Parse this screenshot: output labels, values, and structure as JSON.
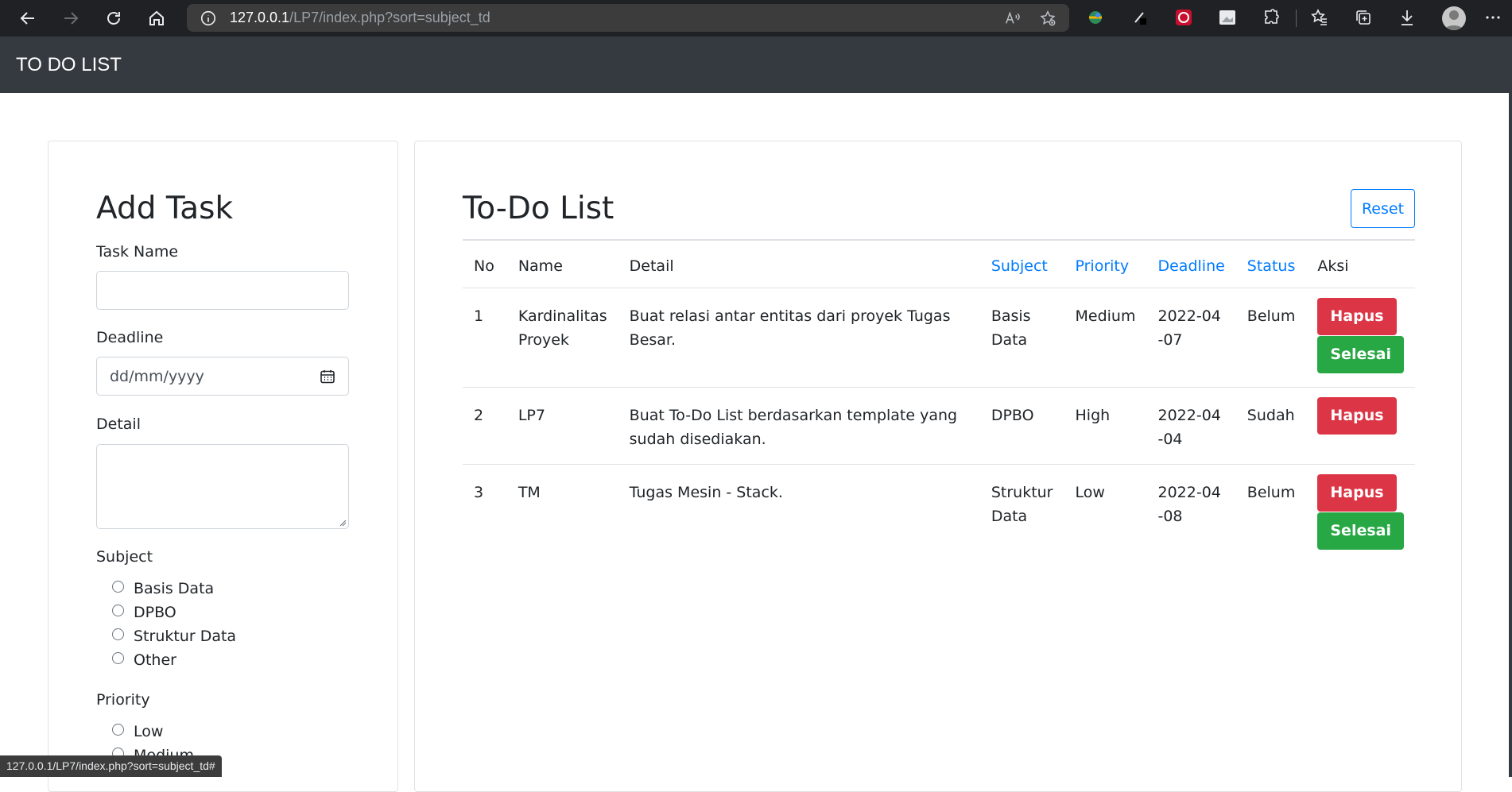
{
  "browser": {
    "url_host": "127.0.0.1",
    "url_path": "/LP7/index.php?sort=subject_td",
    "icons": [
      "back-icon",
      "forward-icon",
      "refresh-icon",
      "home-icon",
      "info-icon",
      "read-aloud-icon",
      "favorite-add-icon",
      "extension-icon",
      "favorites-icon",
      "collections-icon",
      "downloads-icon",
      "profile-icon",
      "more-icon"
    ]
  },
  "navbar": {
    "brand": "TO DO LIST"
  },
  "form": {
    "title": "Add Task",
    "task_name_label": "Task Name",
    "deadline_label": "Deadline",
    "deadline_placeholder": "dd/mm/yyyy",
    "detail_label": "Detail",
    "subject_label": "Subject",
    "subjects": [
      "Basis Data",
      "DPBO",
      "Struktur Data",
      "Other"
    ],
    "priority_label": "Priority",
    "priorities": [
      "Low",
      "Medium"
    ]
  },
  "list": {
    "title": "To-Do List",
    "reset_label": "Reset",
    "columns": [
      "No",
      "Name",
      "Detail",
      "Subject",
      "Priority",
      "Deadline",
      "Status",
      "Aksi"
    ],
    "rows": [
      {
        "no": "1",
        "name": "Kardinalitas Proyek",
        "detail": "Buat relasi antar entitas dari proyek Tugas Besar.",
        "subject": "Basis Data",
        "priority": "Medium",
        "deadline": "2022-04-07",
        "status": "Belum"
      },
      {
        "no": "2",
        "name": "LP7",
        "detail": "Buat To-Do List berdasarkan template yang sudah disediakan.",
        "subject": "DPBO",
        "priority": "High",
        "deadline": "2022-04-04",
        "status": "Sudah"
      },
      {
        "no": "3",
        "name": "TM",
        "detail": "Tugas Mesin - Stack.",
        "subject": "Struktur Data",
        "priority": "Low",
        "deadline": "2022-04-08",
        "status": "Belum"
      }
    ],
    "delete_label": "Hapus",
    "done_label": "Selesai"
  },
  "status_bar": {
    "link_url": "127.0.0.1/LP7/index.php?sort=subject_td#"
  },
  "colors": {
    "navbar": "#343a40",
    "primary": "#007bff",
    "danger": "#dc3545",
    "success": "#28a745"
  }
}
